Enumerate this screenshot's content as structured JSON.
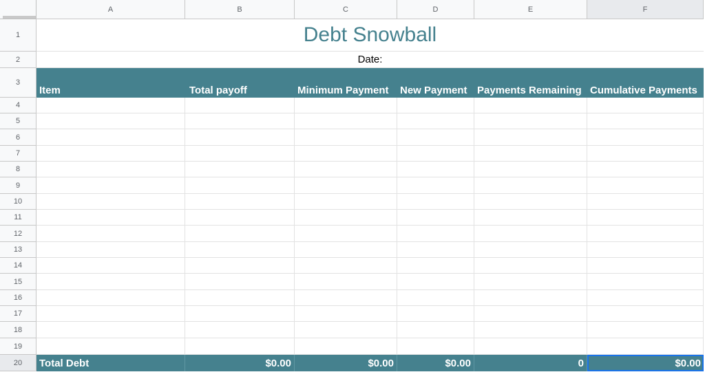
{
  "sheet": {
    "columns": [
      "A",
      "B",
      "C",
      "D",
      "E",
      "F"
    ],
    "rows": [
      "1",
      "2",
      "3",
      "4",
      "5",
      "6",
      "7",
      "8",
      "9",
      "10",
      "11",
      "12",
      "13",
      "14",
      "15",
      "16",
      "17",
      "18",
      "19",
      "20"
    ],
    "title": "Debt Snowball",
    "date_label": "Date:",
    "headers": {
      "item": "Item",
      "total_payoff": "Total payoff",
      "minimum_payment": "Minimum Payment",
      "new_payment": "New Payment",
      "payments_remaining": "Payments Remaining",
      "cumulative_payments": "Cumulative Payments"
    },
    "totals": {
      "label": "Total Debt",
      "total_payoff": "$0.00",
      "minimum_payment": "$0.00",
      "new_payment": "$0.00",
      "payments_remaining": "0",
      "cumulative_payments": "$0.00"
    }
  },
  "colors": {
    "accent": "#45818e",
    "title_text": "#45818e",
    "selection": "#1a73e8"
  }
}
